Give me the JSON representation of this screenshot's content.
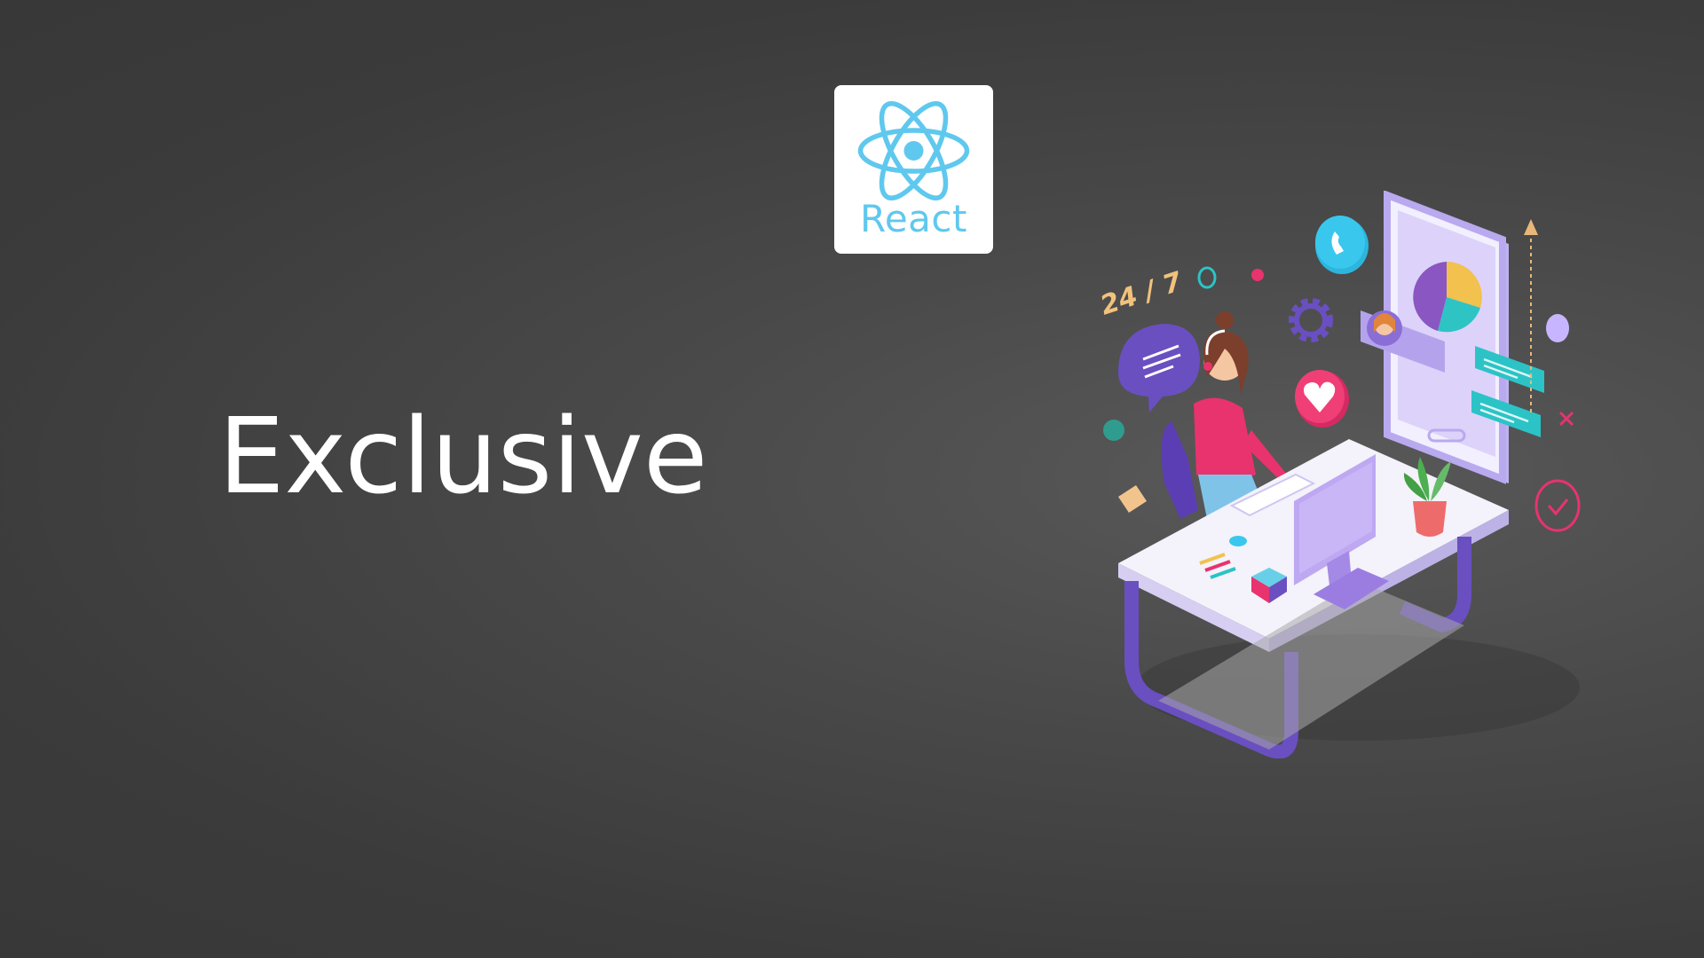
{
  "logo": {
    "icon": "react-atom-icon",
    "text": "React",
    "color": "#5fc8ee"
  },
  "headline": "Exclusive",
  "illustration": {
    "hours_label": "24 / 7",
    "icons": [
      "chat-bubble-icon",
      "phone-icon",
      "gear-icon",
      "heart-icon",
      "pie-chart-icon",
      "avatar-icon",
      "check-icon",
      "arrow-up-icon"
    ]
  },
  "colors": {
    "background": "#3f3f3f",
    "text": "#ffffff",
    "purple": "#6a4fc1",
    "pink": "#e8336e",
    "teal": "#2cc3c6"
  }
}
